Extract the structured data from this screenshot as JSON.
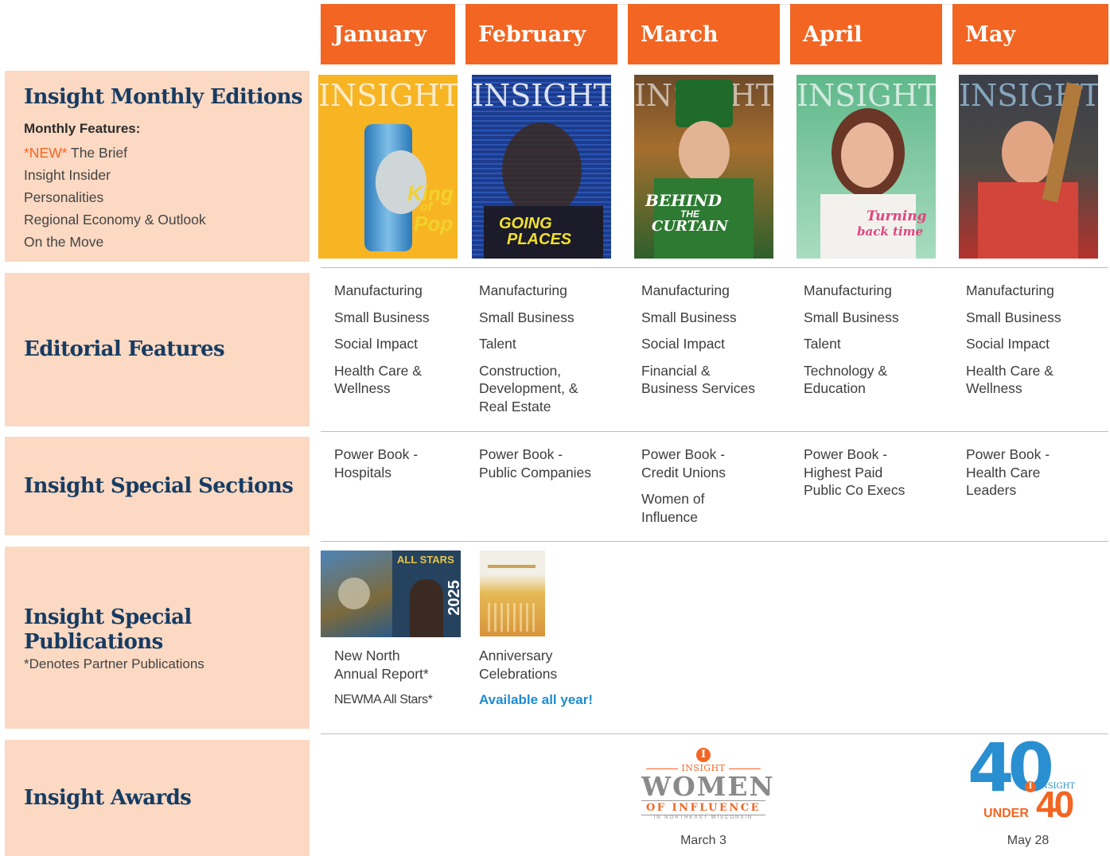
{
  "months": [
    "January",
    "February",
    "March",
    "April",
    "May"
  ],
  "rows": {
    "monthly": {
      "title": "Insight Monthly Editions",
      "features_head": "Monthly Features:",
      "new_tag": "*NEW*",
      "features": [
        " The Brief",
        "Insight Insider",
        "Personalities",
        "Regional Economy & Outlook",
        "On the Move"
      ]
    },
    "editorial": {
      "title": "Editorial Features"
    },
    "special_sections": {
      "title": "Insight Special Sections"
    },
    "special_pubs": {
      "title_line1": "Insight Special",
      "title_line2": "Publications",
      "note": "*Denotes Partner Publications"
    },
    "awards": {
      "title": "Insight Awards"
    }
  },
  "covers": [
    {
      "masthead": "INSIGHT",
      "headline_1": "King",
      "headline_2": "of",
      "headline_3": "Pop",
      "bg": "#f7b524"
    },
    {
      "masthead": "INSIGHT",
      "headline_1": "GOING",
      "headline_2": "PLACES",
      "bg": "#1d3b8c"
    },
    {
      "masthead": "INSIGHT",
      "headline_1": "BEHIND",
      "headline_2": "THE",
      "headline_3": "CURTAIN",
      "bg": "#2f6b32"
    },
    {
      "masthead": "INSIGHT",
      "headline_1": "Turning",
      "headline_2": "back time",
      "bg": "#7fc8a0"
    },
    {
      "masthead": "INSIGHT",
      "bg": "#b3322d"
    }
  ],
  "editorial": [
    [
      "Manufacturing",
      "Small Business",
      "Social Impact",
      "Health Care &\nWellness"
    ],
    [
      "Manufacturing",
      "Small Business",
      "Talent",
      "Construction,\nDevelopment, &\nReal Estate"
    ],
    [
      "Manufacturing",
      "Small Business",
      "Social Impact",
      "Financial &\nBusiness Services"
    ],
    [
      "Manufacturing",
      "Small Business",
      "Talent",
      "Technology &\nEducation"
    ],
    [
      "Manufacturing",
      "Small Business",
      "Social Impact",
      "Health Care &\nWellness"
    ]
  ],
  "special_sections": [
    [
      "Power Book  -\nHospitals"
    ],
    [
      "Power Book -\nPublic Companies"
    ],
    [
      "Power Book -\nCredit Unions",
      "Women of\nInfluence"
    ],
    [
      "Power Book -\nHighest Paid\nPublic Co Execs"
    ],
    [
      "Power Book -\nHealth Care\nLeaders"
    ]
  ],
  "special_publications": {
    "jan": {
      "item1": "New North\nAnnual Report*",
      "item2": "NEWMA All Stars*",
      "thumb_text": "ALL STARS",
      "thumb_year": "2025"
    },
    "feb": {
      "item1": "Anniversary\nCelebrations",
      "item2": "Available all year!"
    }
  },
  "awards": {
    "woi": {
      "brand": "INSIGHT",
      "line1": "WOMEN",
      "line2": "OF INFLUENCE",
      "line3": "IN NORTHEAST WISCONSIN",
      "date": "March 3"
    },
    "forty": {
      "big": "40",
      "small": "40",
      "under": "UNDER",
      "brand": "INSIGHT",
      "date": "May 28"
    }
  },
  "colors": {
    "orange": "#f26522",
    "peach": "#fbd9c3",
    "navy": "#173c63",
    "blue_link": "#1f8bd1"
  }
}
